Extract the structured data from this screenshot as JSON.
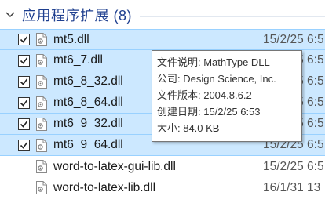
{
  "group": {
    "title": "应用程序扩展 (8)"
  },
  "files": [
    {
      "name": "mt5.dll",
      "date": "15/2/25 6:5",
      "checked": true,
      "selected": true
    },
    {
      "name": "mt6_7.dll",
      "date": "15/2/25 6:5",
      "checked": true,
      "selected": true
    },
    {
      "name": "mt6_8_32.dll",
      "date": "15/2/25 6:5",
      "checked": true,
      "selected": true
    },
    {
      "name": "mt6_8_64.dll",
      "date": "15/2/25 6:5",
      "checked": true,
      "selected": true
    },
    {
      "name": "mt6_9_32.dll",
      "date": "15/2/25 6:5",
      "checked": true,
      "selected": true
    },
    {
      "name": "mt6_9_64.dll",
      "date": "15/2/25 6:5",
      "checked": true,
      "selected": true
    },
    {
      "name": "word-to-latex-gui-lib.dll",
      "date": "15/2/25 6:5",
      "checked": false,
      "selected": false
    },
    {
      "name": "word-to-latex-lib.dll",
      "date": "16/1/31 13",
      "checked": false,
      "selected": false
    }
  ],
  "tooltip": {
    "description": "文件说明: MathType DLL",
    "company": "公司: Design Science, Inc.",
    "version": "文件版本: 2004.8.6.2",
    "created": "创建日期: 15/2/25 6:53",
    "size": "大小: 84.0 KB"
  },
  "colors": {
    "selection_bg": "#cce8ff",
    "selection_border": "#99d1ff",
    "group_title": "#1e3f8f"
  }
}
